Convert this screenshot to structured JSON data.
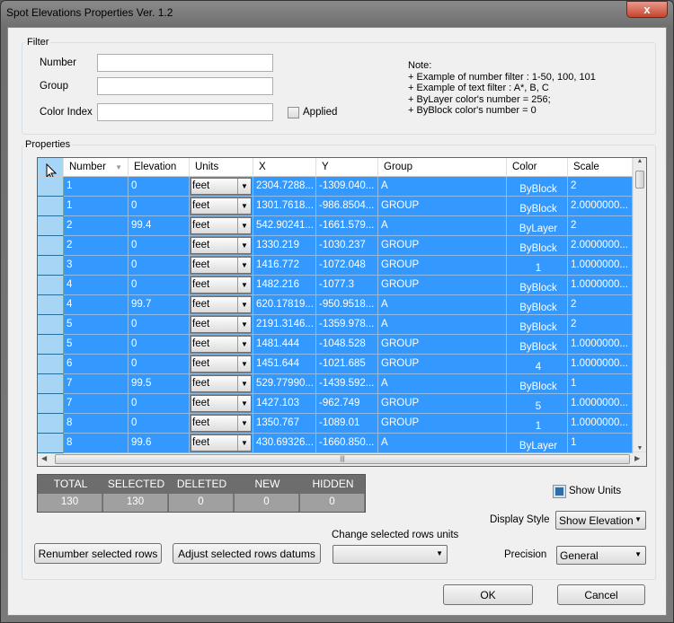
{
  "window": {
    "title": "Spot Elevations Properties Ver. 1.2",
    "close_label": "x"
  },
  "filter": {
    "group_label": "Filter",
    "number_label": "Number",
    "number_value": "",
    "group_field_label": "Group",
    "group_value": "",
    "color_label": "Color Index",
    "color_value": "",
    "applied_label": "Applied",
    "applied_checked": false,
    "note": [
      "Note:",
      "+ Example of number filter : 1-50, 100, 101",
      "+ Example of text filter : A*, B, C",
      "+ ByLayer color's number = 256;",
      "+ ByBlock color's number = 0"
    ]
  },
  "properties": {
    "group_label": "Properties",
    "columns": [
      "Number",
      "Elevation",
      "Units",
      "X",
      "Y",
      "Group",
      "Color",
      "Scale"
    ],
    "sort_column": "Number",
    "selection_color": "#3399ff",
    "rows": [
      [
        "1",
        "0",
        "feet",
        "2304.7288...",
        "-1309.040...",
        "A",
        "ByBlock",
        "2"
      ],
      [
        "1",
        "0",
        "feet",
        "1301.7618...",
        "-986.8504...",
        "GROUP",
        "ByBlock",
        "2.0000000..."
      ],
      [
        "2",
        "99.4",
        "feet",
        "542.90241...",
        "-1661.579...",
        "A",
        "ByLayer",
        "2"
      ],
      [
        "2",
        "0",
        "feet",
        "1330.219",
        "-1030.237",
        "GROUP",
        "ByBlock",
        "2.0000000..."
      ],
      [
        "3",
        "0",
        "feet",
        "1416.772",
        "-1072.048",
        "GROUP",
        "1",
        "1.0000000..."
      ],
      [
        "4",
        "0",
        "feet",
        "1482.216",
        "-1077.3",
        "GROUP",
        "ByBlock",
        "1.0000000..."
      ],
      [
        "4",
        "99.7",
        "feet",
        "620.17819...",
        "-950.9518...",
        "A",
        "ByBlock",
        "2"
      ],
      [
        "5",
        "0",
        "feet",
        "2191.3146...",
        "-1359.978...",
        "A",
        "ByBlock",
        "2"
      ],
      [
        "5",
        "0",
        "feet",
        "1481.444",
        "-1048.528",
        "GROUP",
        "ByBlock",
        "1.0000000..."
      ],
      [
        "6",
        "0",
        "feet",
        "1451.644",
        "-1021.685",
        "GROUP",
        "4",
        "1.0000000..."
      ],
      [
        "7",
        "99.5",
        "feet",
        "529.77990...",
        "-1439.592...",
        "A",
        "ByBlock",
        "1"
      ],
      [
        "7",
        "0",
        "feet",
        "1427.103",
        "-962.749",
        "GROUP",
        "5",
        "1.0000000..."
      ],
      [
        "8",
        "0",
        "feet",
        "1350.767",
        "-1089.01",
        "GROUP",
        "1",
        "1.0000000..."
      ],
      [
        "8",
        "99.6",
        "feet",
        "430.69326...",
        "-1660.850...",
        "A",
        "ByLayer",
        "1"
      ]
    ]
  },
  "stats": {
    "headers": [
      "TOTAL",
      "SELECTED",
      "DELETED",
      "NEW",
      "HIDDEN"
    ],
    "values": [
      "130",
      "130",
      "0",
      "0",
      "0"
    ]
  },
  "controls": {
    "show_units_label": "Show Units",
    "show_units_checked": true,
    "display_style_label": "Display Style",
    "display_style_value": "Show Elevation",
    "change_units_label": "Change selected rows units",
    "change_units_value": "",
    "precision_label": "Precision",
    "precision_value": "General",
    "renumber_label": "Renumber selected rows",
    "adjust_label": "Adjust selected rows datums",
    "ok_label": "OK",
    "cancel_label": "Cancel"
  }
}
